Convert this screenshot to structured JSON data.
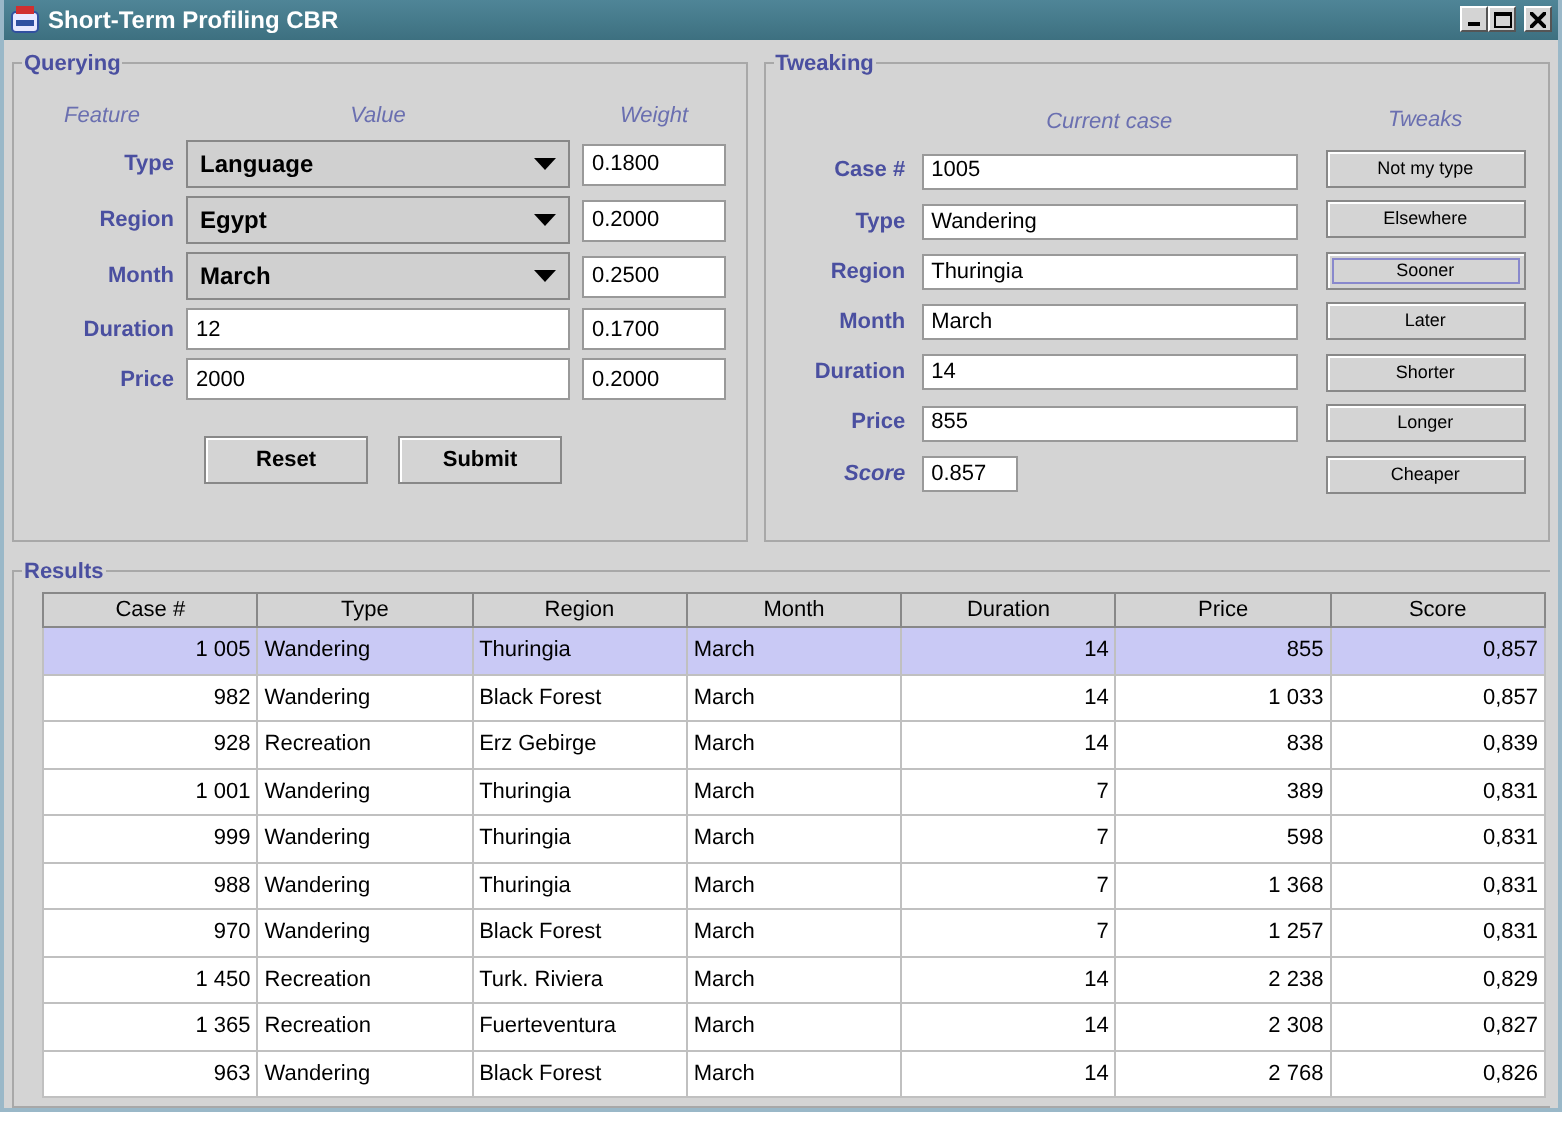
{
  "window": {
    "title": "Short-Term Profiling CBR"
  },
  "querying": {
    "title": "Querying",
    "headers": [
      "Feature",
      "Value",
      "Weight"
    ],
    "rows": [
      {
        "label": "Type",
        "kind": "dropdown",
        "value": "Language",
        "weight": "0.1800"
      },
      {
        "label": "Region",
        "kind": "dropdown",
        "value": "Egypt",
        "weight": "0.2000"
      },
      {
        "label": "Month",
        "kind": "dropdown",
        "value": "March",
        "weight": "0.2500"
      },
      {
        "label": "Duration",
        "kind": "text",
        "value": "12",
        "weight": "0.1700"
      },
      {
        "label": "Price",
        "kind": "text",
        "value": "2000",
        "weight": "0.2000"
      }
    ],
    "buttons": [
      "Reset",
      "Submit"
    ]
  },
  "tweaking": {
    "title": "Tweaking",
    "headers": [
      "Current case",
      "Tweaks"
    ],
    "fields": [
      {
        "label": "Case #",
        "kind": "field",
        "value": "1005"
      },
      {
        "label": "Type",
        "kind": "field",
        "value": "Wandering"
      },
      {
        "label": "Region",
        "kind": "field",
        "value": "Thuringia"
      },
      {
        "label": "Month",
        "kind": "field",
        "value": "March"
      },
      {
        "label": "Duration",
        "kind": "field",
        "value": "14"
      },
      {
        "label": "Price",
        "kind": "field",
        "value": "855"
      },
      {
        "label": "Score",
        "kind": "score",
        "value": "0.857"
      }
    ],
    "tweaks": [
      {
        "label": "Not my type",
        "focused": false
      },
      {
        "label": "Elsewhere",
        "focused": false
      },
      {
        "label": "Sooner",
        "focused": true
      },
      {
        "label": "Later",
        "focused": false
      },
      {
        "label": "Shorter",
        "focused": false
      },
      {
        "label": "Longer",
        "focused": false
      },
      {
        "label": "Cheaper",
        "focused": false
      }
    ]
  },
  "results": {
    "title": "Results",
    "columns": [
      "Case #",
      "Type",
      "Region",
      "Month",
      "Duration",
      "Price",
      "Score"
    ],
    "rows": [
      {
        "selected": true,
        "cells": [
          "1 005",
          "Wandering",
          "Thuringia",
          "March",
          "14",
          "855",
          "0,857"
        ]
      },
      {
        "selected": false,
        "cells": [
          "982",
          "Wandering",
          "Black Forest",
          "March",
          "14",
          "1 033",
          "0,857"
        ]
      },
      {
        "selected": false,
        "cells": [
          "928",
          "Recreation",
          "Erz Gebirge",
          "March",
          "14",
          "838",
          "0,839"
        ]
      },
      {
        "selected": false,
        "cells": [
          "1 001",
          "Wandering",
          "Thuringia",
          "March",
          "7",
          "389",
          "0,831"
        ]
      },
      {
        "selected": false,
        "cells": [
          "999",
          "Wandering",
          "Thuringia",
          "March",
          "7",
          "598",
          "0,831"
        ]
      },
      {
        "selected": false,
        "cells": [
          "988",
          "Wandering",
          "Thuringia",
          "March",
          "7",
          "1 368",
          "0,831"
        ]
      },
      {
        "selected": false,
        "cells": [
          "970",
          "Wandering",
          "Black Forest",
          "March",
          "7",
          "1 257",
          "0,831"
        ]
      },
      {
        "selected": false,
        "cells": [
          "1 450",
          "Recreation",
          "Turk. Riviera",
          "March",
          "14",
          "2 238",
          "0,829"
        ]
      },
      {
        "selected": false,
        "cells": [
          "1 365",
          "Recreation",
          "Fuerteventura",
          "March",
          "14",
          "2 308",
          "0,827"
        ]
      },
      {
        "selected": false,
        "cells": [
          "963",
          "Wandering",
          "Black Forest",
          "March",
          "14",
          "2 768",
          "0,826"
        ]
      }
    ]
  }
}
